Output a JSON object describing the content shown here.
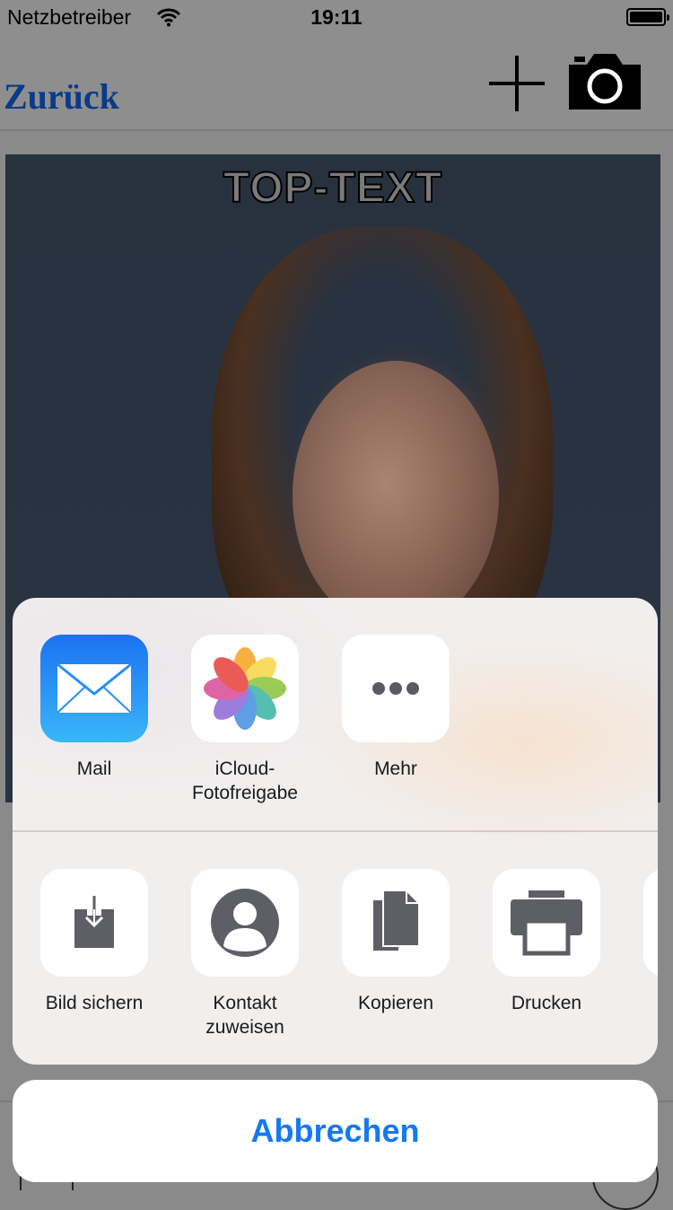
{
  "status_bar": {
    "carrier": "Netzbetreiber",
    "time": "19:11"
  },
  "nav": {
    "back_label": "Zurück"
  },
  "photo": {
    "top_text": "TOP-TEXT"
  },
  "share_sheet": {
    "apps": [
      {
        "label": "Mail",
        "icon": "mail-icon"
      },
      {
        "label": "iCloud-\nFotofreigabe",
        "icon": "photos-icon"
      },
      {
        "label": "Mehr",
        "icon": "more-icon"
      }
    ],
    "actions": [
      {
        "label": "Bild sichern",
        "icon": "save-image-icon"
      },
      {
        "label": "Kontakt\nzuweisen",
        "icon": "contact-icon"
      },
      {
        "label": "Kopieren",
        "icon": "copy-icon"
      },
      {
        "label": "Drucken",
        "icon": "print-icon"
      }
    ],
    "cancel_label": "Abbrechen"
  },
  "colors": {
    "accent": "#1478f5",
    "back_link": "#0a3a8a"
  }
}
